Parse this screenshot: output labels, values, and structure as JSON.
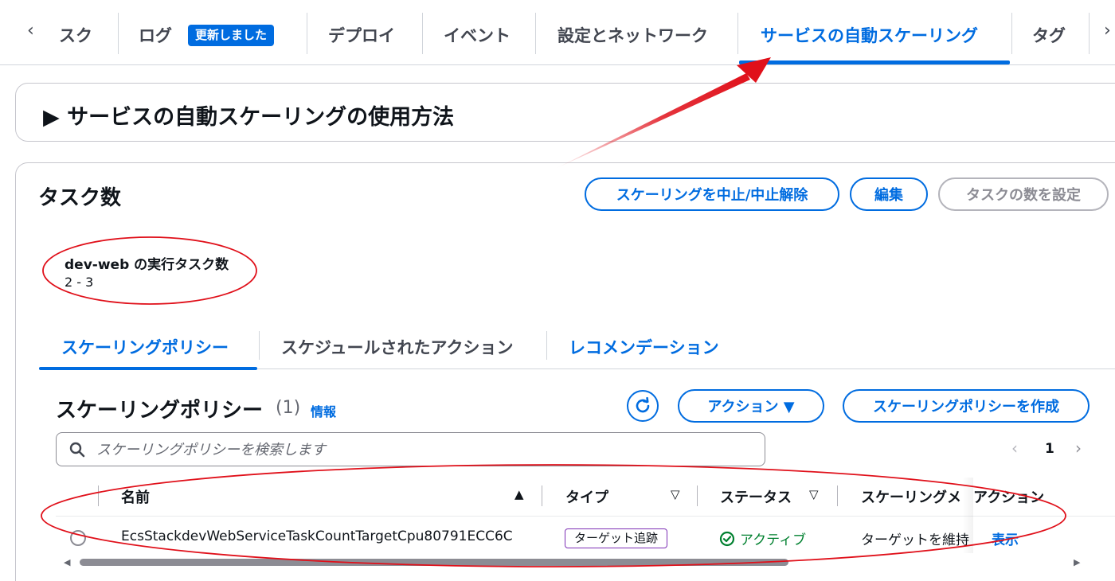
{
  "top_tabs": {
    "prev_arrow": "‹",
    "next_arrow": "›",
    "items": [
      {
        "label": "スク"
      },
      {
        "label": "ログ",
        "badge": "更新しました"
      },
      {
        "label": "デプロイ"
      },
      {
        "label": "イベント"
      },
      {
        "label": "設定とネットワーク"
      },
      {
        "label": "サービスの自動スケーリング",
        "active": true
      },
      {
        "label": "タグ"
      }
    ]
  },
  "howto_panel": {
    "title": "▶ サービスの自動スケーリングの使用方法"
  },
  "task_count": {
    "title": "タスク数",
    "buttons": {
      "suspend": "スケーリングを中止/中止解除",
      "edit": "編集",
      "set_count": "タスクの数を設定"
    },
    "label": "dev-web の実行タスク数",
    "value": "2 - 3"
  },
  "sub_tabs": [
    {
      "label": "スケーリングポリシー",
      "active": true
    },
    {
      "label": "スケジュールされたアクション"
    },
    {
      "label": "レコメンデーション"
    }
  ],
  "policies": {
    "title": "スケーリングポリシー",
    "count": "(1)",
    "info": "情報",
    "actions_button": "アクション ▼",
    "create_button": "スケーリングポリシーを作成",
    "search_placeholder": "スケーリングポリシーを検索します",
    "page": "1",
    "columns": {
      "name": "名前",
      "type": "タイプ",
      "status": "ステータス",
      "metric": "スケーリングメ",
      "action": "アクション"
    },
    "rows": [
      {
        "name": "EcsStackdevWebServiceTaskCountTargetCpu80791ECC6C",
        "type": "ターゲット追跡",
        "status": "アクティブ",
        "metric": "ターゲットを維持",
        "action": "表示"
      }
    ]
  },
  "colors": {
    "accent": "#006ce0",
    "success": "#00802f",
    "annotation": "#e0101a"
  }
}
